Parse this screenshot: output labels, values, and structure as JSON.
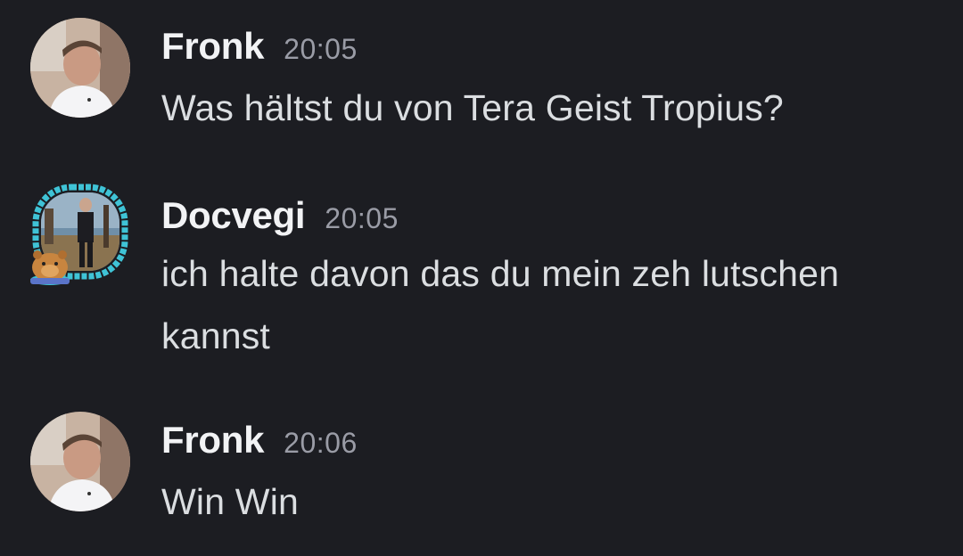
{
  "messages": [
    {
      "author": "Fronk",
      "time": "20:05",
      "text": "Was hältst du von Tera Geist Tropius?",
      "avatar_icon": "user-photo-avatar"
    },
    {
      "author": "Docvegi",
      "time": "20:05",
      "text": "ich halte davon das du mein zeh lutschen kannst",
      "avatar_icon": "user-photo-avatar-with-capybara-decoration"
    },
    {
      "author": "Fronk",
      "time": "20:06",
      "text": "Win Win",
      "avatar_icon": "user-photo-avatar"
    }
  ],
  "colors": {
    "background": "#1c1d22",
    "username": "#f2f3f5",
    "timestamp": "#9a9ca6",
    "message_text": "#dbdee1",
    "avatar_decoration_frame": "#3fc3d6"
  }
}
